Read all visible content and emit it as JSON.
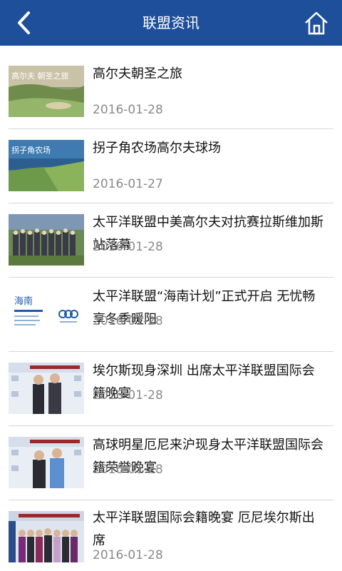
{
  "header": {
    "title": "联盟资讯",
    "back_icon": "chevron-left-icon",
    "home_icon": "home-icon",
    "color": "#1e4f9a"
  },
  "news": [
    {
      "title": "高尔夫朝圣之旅",
      "date": "2016-01-28",
      "thumb_text": "高尔夫 朝圣之旅"
    },
    {
      "title": "拐子角农场高尔夫球场",
      "date": "2016-01-27",
      "thumb_text": "拐子角农场"
    },
    {
      "title": "太平洋联盟中美高尔夫对抗赛拉斯维加斯站落幕",
      "date": "2016-01-28"
    },
    {
      "title": "太平洋联盟“海南计划”正式开启 无忧畅享冬季暖阳",
      "date": "2016-01-28",
      "thumb_text": "海南"
    },
    {
      "title": "埃尔斯现身深圳 出席太平洋联盟国际会籍晚宴",
      "date": "2016-01-28"
    },
    {
      "title": "高球明星厄尼来沪现身太平洋联盟国际会籍荣誉晚宴",
      "date": "2016-01-28"
    },
    {
      "title": "太平洋联盟国际会籍晚宴 厄尼埃尔斯出席",
      "date": "2016-01-28"
    }
  ]
}
